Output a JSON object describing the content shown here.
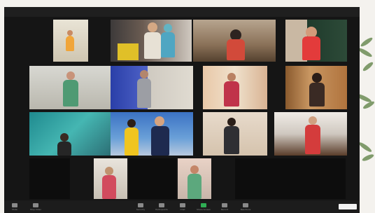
{
  "meeting": {
    "toolbar": [
      "Mute",
      "Stop Video",
      "",
      "Security",
      "Participants",
      "Chat",
      "Share Screen",
      "Record",
      "Reactions"
    ]
  },
  "colors": {
    "background": "#151515",
    "toolbar": "#1c1c1c",
    "share": "#2fae54"
  }
}
